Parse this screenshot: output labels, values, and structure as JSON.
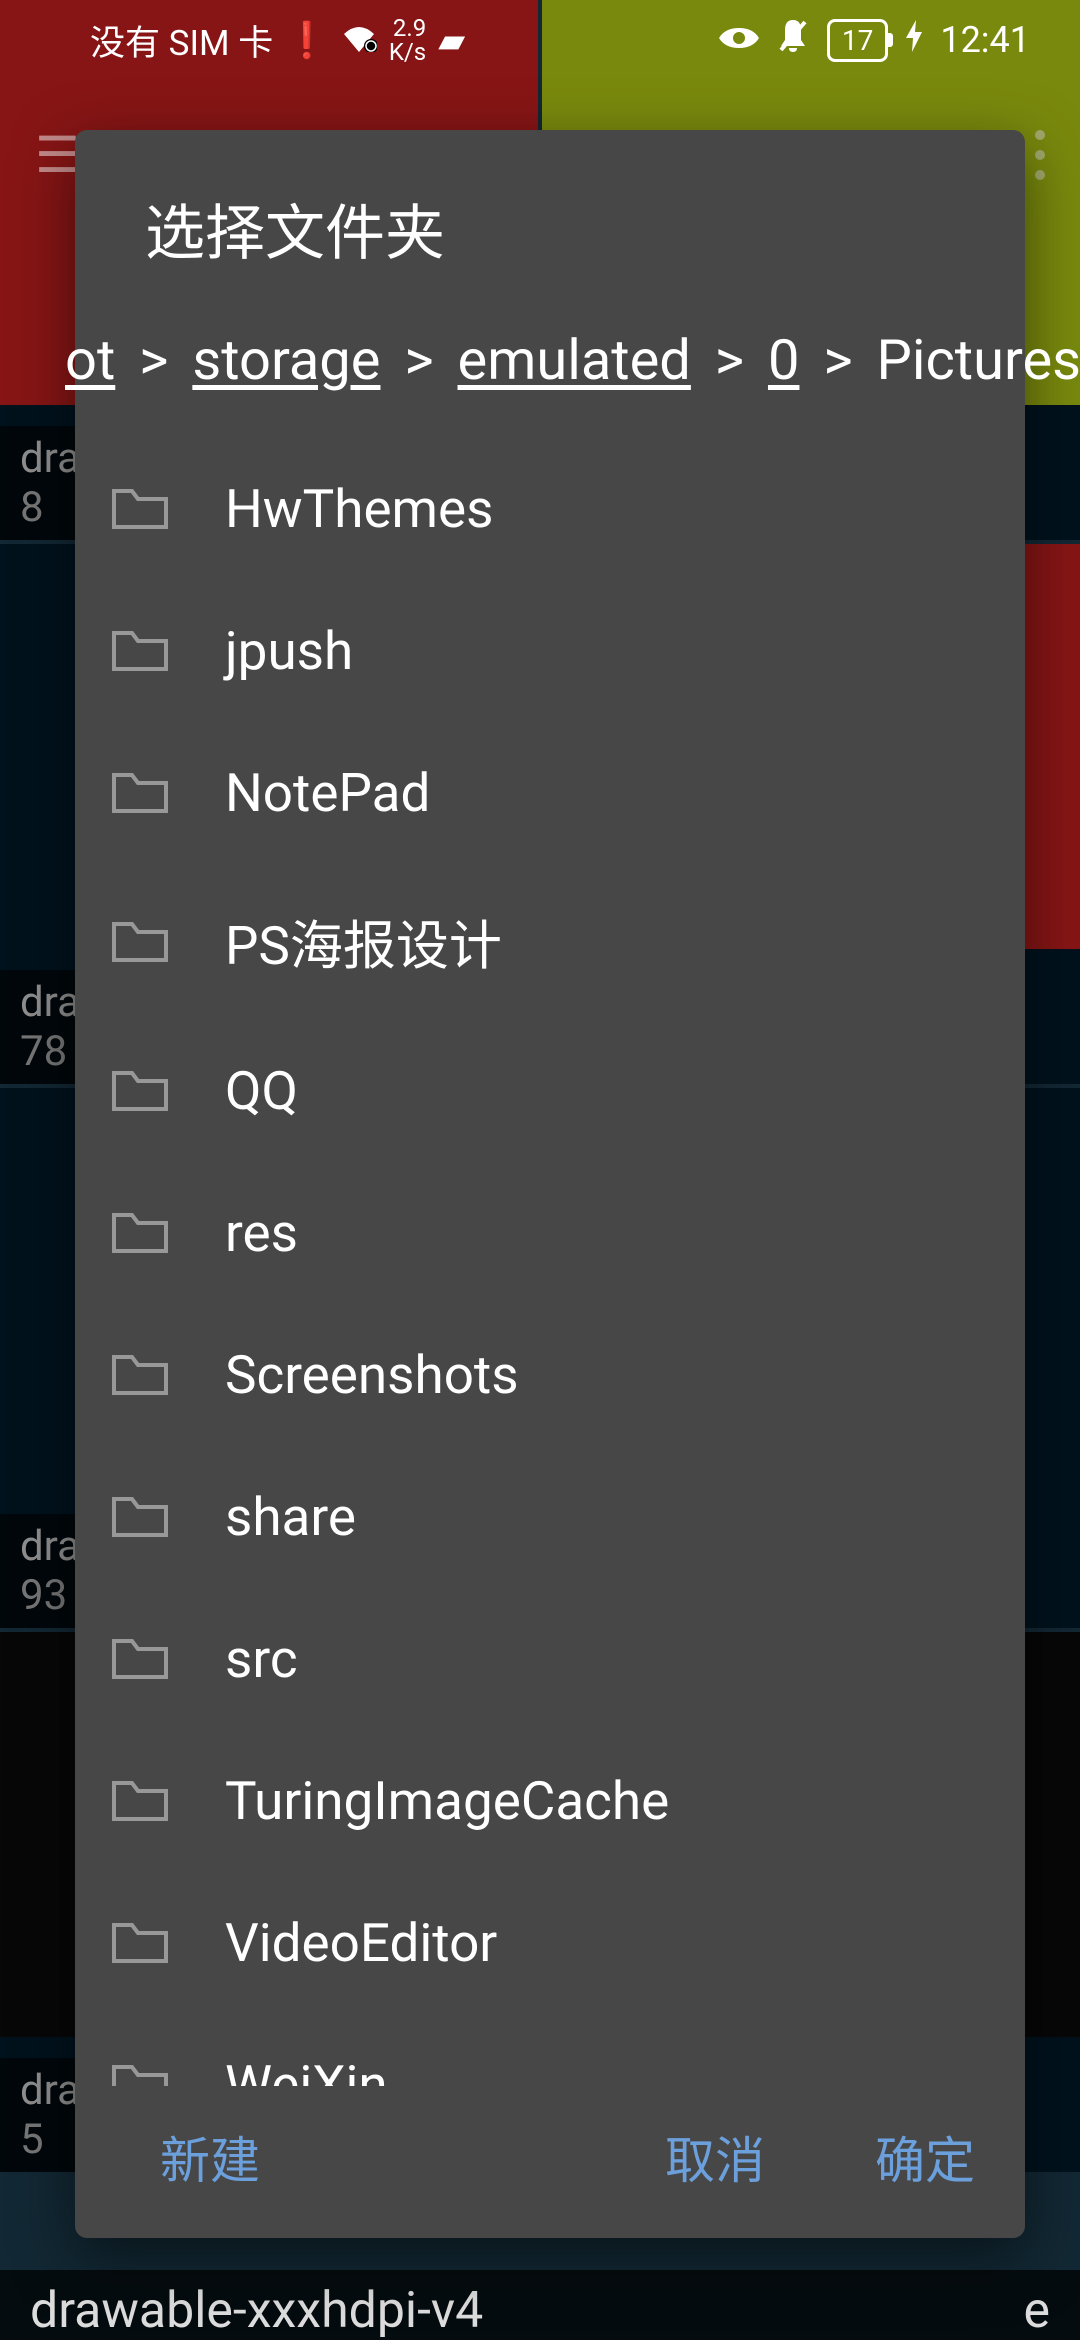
{
  "status_bar": {
    "sim_text": "没有 SIM 卡",
    "net_speed_value": "2.9",
    "net_speed_unit": "K/s",
    "battery_pct": "17",
    "time": "12:41"
  },
  "background": {
    "cells": [
      {
        "label": "dra",
        "count": "8"
      },
      {
        "label": "",
        "count": ""
      },
      {
        "label": "dra",
        "count": "78"
      },
      {
        "label": "",
        "count": ""
      },
      {
        "label": "dra",
        "count": "93"
      },
      {
        "label": "",
        "count": ""
      },
      {
        "label": "dra",
        "count": "5"
      },
      {
        "label": "",
        "count": ""
      }
    ],
    "bottom_left": "drawable-xxxhdpi-v4",
    "bottom_right": "e"
  },
  "dialog": {
    "title": "选择文件夹",
    "breadcrumb": {
      "segments": [
        {
          "label": "ot",
          "link": true
        },
        {
          "label": "storage",
          "link": true
        },
        {
          "label": "emulated",
          "link": true
        },
        {
          "label": "0",
          "link": true
        },
        {
          "label": "Pictures",
          "link": false
        }
      ],
      "separator": ">"
    },
    "folders": [
      {
        "name": "HwThemes"
      },
      {
        "name": "jpush"
      },
      {
        "name": "NotePad"
      },
      {
        "name": "PS海报设计"
      },
      {
        "name": "QQ"
      },
      {
        "name": "res"
      },
      {
        "name": "Screenshots"
      },
      {
        "name": "share"
      },
      {
        "name": "src"
      },
      {
        "name": "TuringImageCache"
      },
      {
        "name": "VideoEditor"
      },
      {
        "name": "WeiXin"
      }
    ],
    "actions": {
      "new_label": "新建",
      "cancel_label": "取消",
      "confirm_label": "确定"
    }
  }
}
